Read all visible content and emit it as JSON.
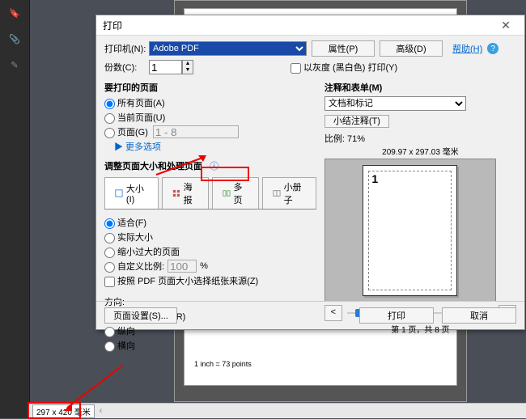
{
  "status_bar": {
    "dims": "297 x 420 毫米"
  },
  "doc": {
    "ruler_text": "1 inch = 73 points"
  },
  "dialog": {
    "title": "打印",
    "close": "✕",
    "printer_label": "打印机(N):",
    "printer_value": "Adobe PDF",
    "props_btn": "属性(P)",
    "advanced_btn": "高级(D)",
    "help_link": "帮助(H)",
    "copies_label": "份数(C):",
    "copies_value": "1",
    "grayscale": "以灰度 (黑白色) 打印(Y)",
    "pages_title": "要打印的页面",
    "pages_all": "所有页面(A)",
    "pages_current": "当前页面(U)",
    "pages_range_label": "页面(G)",
    "pages_range_value": "1 - 8",
    "pages_more": "▶ 更多选项",
    "size_title": "调整页面大小和处理页面",
    "info_icon": "ⓘ",
    "tab_size": "大小(I)",
    "tab_poster": "海报",
    "tab_multi": "多页",
    "tab_booklet": "小册子",
    "fit": "适合(F)",
    "actual": "实际大小",
    "shrink": "缩小过大的页面",
    "custom_scale": "自定义比例:",
    "custom_scale_val": "100",
    "percent": "%",
    "source": "按照 PDF 页面大小选择纸张来源(Z)",
    "orient_title": "方向:",
    "orient_auto": "自动纵向/横向(R)",
    "orient_portrait": "纵向",
    "orient_landscape": "横向",
    "comments_title": "注释和表单(M)",
    "comments_combo": "文档和标记",
    "summarize_btn": "小结注释(T)",
    "scale_label": "比例:",
    "scale_value": "71%",
    "preview_dims": "209.97 x 297.03 毫米",
    "preview_page_num": "1",
    "page_info": "第 1 页，共 8 页",
    "prev": "<",
    "next": ">",
    "page_setup": "页面设置(S)...",
    "print": "打印",
    "cancel": "取消"
  }
}
